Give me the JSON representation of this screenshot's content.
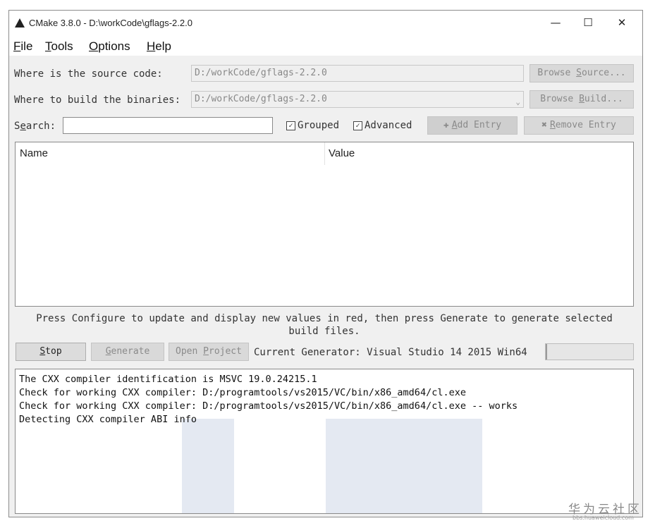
{
  "window": {
    "title": "CMake 3.8.0 - D:\\workCode\\gflags-2.2.0",
    "controls": {
      "minimize": "—",
      "maximize": "☐",
      "close": "✕"
    }
  },
  "menu": {
    "items": [
      {
        "accel": "F",
        "rest": "ile"
      },
      {
        "accel": "T",
        "rest": "ools"
      },
      {
        "accel": "O",
        "rest": "ptions"
      },
      {
        "accel": "H",
        "rest": "elp"
      }
    ]
  },
  "source": {
    "label": "Where is the source code:",
    "value": "D:/workCode/gflags-2.2.0",
    "browse_button": {
      "pre": "Browse ",
      "accel": "S",
      "post": "ource..."
    }
  },
  "build": {
    "label": "Where to build the binaries:",
    "value": "D:/workCode/gflags-2.2.0",
    "dropdown_arrow": "⌄",
    "browse_button": {
      "pre": "Browse ",
      "accel": "B",
      "post": "uild..."
    }
  },
  "search": {
    "label_pre": "S",
    "label_accel": "e",
    "label_post": "arch:",
    "value": ""
  },
  "options": {
    "grouped": {
      "label": "Grouped",
      "checked": true,
      "mark": "✓"
    },
    "advanced": {
      "label": "Advanced",
      "checked": true,
      "mark": "✓"
    }
  },
  "entry_buttons": {
    "add": {
      "icon": "✚",
      "accel": "A",
      "rest": "dd Entry"
    },
    "remove": {
      "icon": "✖",
      "accel": "R",
      "rest": "emove Entry"
    }
  },
  "table": {
    "columns": [
      "Name",
      "Value"
    ],
    "rows": []
  },
  "info_text": {
    "line1": "Press Configure to update and display new values in red, then press Generate to generate selected",
    "line2": "build files."
  },
  "actions": {
    "stop": {
      "accel": "S",
      "rest": "top"
    },
    "generate": {
      "accel": "G",
      "rest": "enerate"
    },
    "open_project": {
      "pre": "Open ",
      "accel": "P",
      "rest": "roject"
    },
    "generator_text": "Current Generator: Visual Studio 14 2015 Win64",
    "progress": 0.02
  },
  "log": {
    "lines": [
      "The CXX compiler identification is MSVC 19.0.24215.1",
      "Check for working CXX compiler: D:/programtools/vs2015/VC/bin/x86_amd64/cl.exe",
      "Check for working CXX compiler: D:/programtools/vs2015/VC/bin/x86_amd64/cl.exe -- works",
      "Detecting CXX compiler ABI info"
    ]
  },
  "watermark": {
    "text": "华为云社区",
    "url": "bbs.huaweicloud.com"
  }
}
